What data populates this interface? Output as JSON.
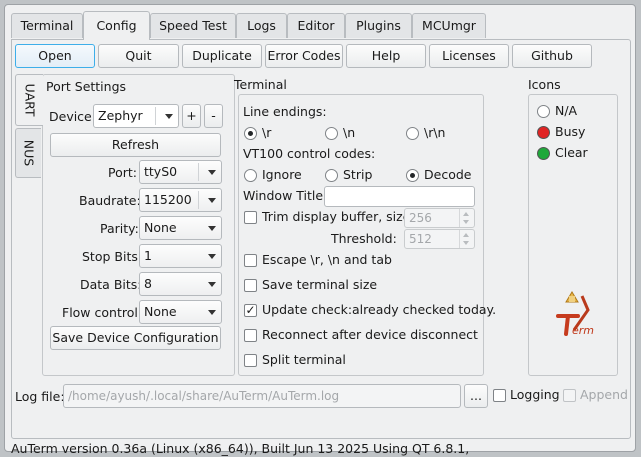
{
  "tabs": [
    "Terminal",
    "Config",
    "Speed Test",
    "Logs",
    "Editor",
    "Plugins",
    "MCUmgr"
  ],
  "active_tab": "Config",
  "buttons": {
    "open": "Open",
    "quit": "Quit",
    "duplicate": "Duplicate",
    "error_codes": "Error Codes",
    "help": "Help",
    "licenses": "Licenses",
    "github": "Github"
  },
  "side_tabs": [
    "UART",
    "NUS"
  ],
  "port_settings": {
    "title": "Port Settings",
    "device_label": "Device",
    "device_value": "Zephyr",
    "plus": "+",
    "minus": "-",
    "refresh": "Refresh",
    "port_label": "Port:",
    "port_value": "ttyS0",
    "baud_label": "Baudrate:",
    "baud_value": "115200",
    "parity_label": "Parity:",
    "parity_value": "None",
    "stopbits_label": "Stop Bits:",
    "stopbits_value": "1",
    "databits_label": "Data Bits:",
    "databits_value": "8",
    "flow_label": "Flow control:",
    "flow_value": "None",
    "save_config": "Save Device Configuration"
  },
  "terminal": {
    "title": "Terminal",
    "line_endings_label": "Line endings:",
    "line_endings": [
      "\\r",
      "\\n",
      "\\r\\n"
    ],
    "line_endings_selected": 0,
    "vt100_label": "VT100 control codes:",
    "vt100_options": [
      "Ignore",
      "Strip",
      "Decode"
    ],
    "vt100_selected": 2,
    "window_title_label": "Window Title:",
    "window_title_value": "",
    "trim_label": "Trim display buffer, size:",
    "trim_checked": false,
    "trim_size": "256",
    "threshold_label": "Threshold:",
    "threshold_value": "512",
    "escape_label": "Escape \\r, \\n and tab",
    "escape_checked": false,
    "save_size_label": "Save terminal size",
    "save_size_checked": false,
    "update_label": "Update check:",
    "update_status": "already checked today.",
    "update_checked": true,
    "reconnect_label": "Reconnect after device disconnect",
    "reconnect_checked": false,
    "split_label": "Split terminal",
    "split_checked": false
  },
  "icons": {
    "title": "Icons",
    "options": [
      {
        "label": "N/A",
        "color": "#ffffff"
      },
      {
        "label": "Busy",
        "color": "#e02424"
      },
      {
        "label": "Clear",
        "color": "#1fa83a"
      }
    ],
    "logo_text": "AuTerm"
  },
  "log": {
    "label": "Log file:",
    "path": "/home/ayush/.local/share/AuTerm/AuTerm.log",
    "browse": "...",
    "logging_label": "Logging",
    "append_label": "Append"
  },
  "status_bar": "AuTerm version 0.36a (Linux (x86_64)), Built Jun 13 2025 Using QT 6.8.1,"
}
